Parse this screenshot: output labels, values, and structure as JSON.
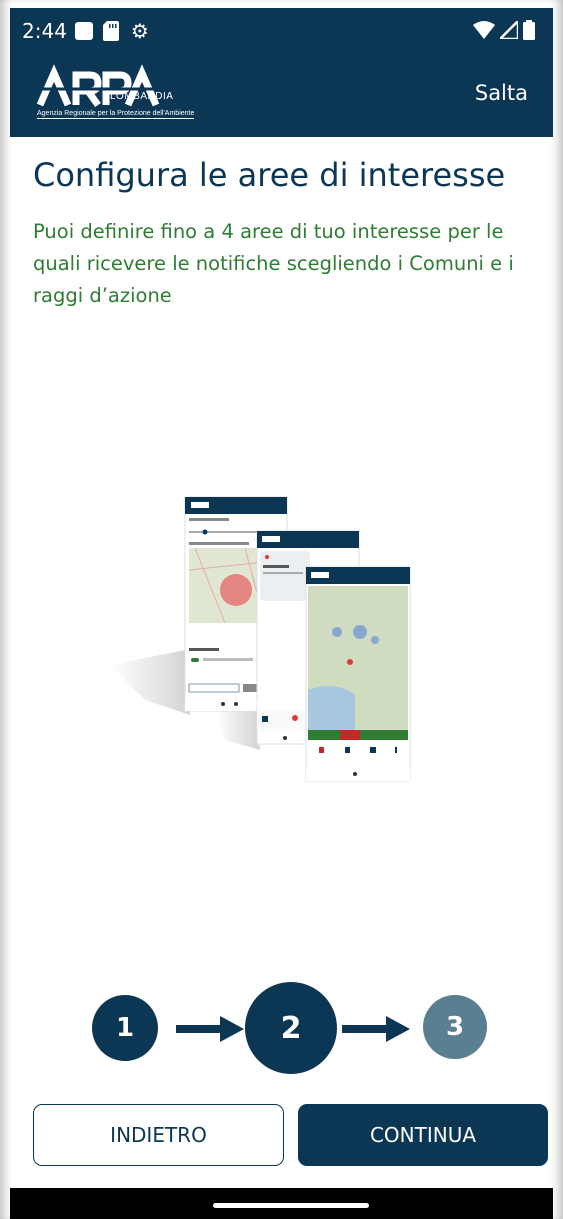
{
  "status_bar": {
    "time": "2:44",
    "icons": [
      "square-notification-icon",
      "sd-card-icon",
      "settings-icon",
      "wifi-icon",
      "signal-icon",
      "battery-icon"
    ]
  },
  "header": {
    "logo_text": "ARPA",
    "logo_region": "LOMBARDIA",
    "logo_subtitle": "Agenzia Regionale per la Protezione dell'Ambiente",
    "skip_label": "Salta"
  },
  "content": {
    "title": "Configura le aree di interesse",
    "description": "Puoi definire fino a 4 aree di tuo interesse per le quali ricevere le notifiche scegliendo i Comuni e i raggi d’azione"
  },
  "steps": {
    "items": [
      "1",
      "2",
      "3"
    ],
    "current": 2
  },
  "buttons": {
    "back_label": "INDIETRO",
    "continue_label": "CONTINUA"
  },
  "colors": {
    "primary": "#0b3654",
    "accent_text": "#2e7d32",
    "step_inactive": "#5a7f90",
    "background": "#ffffff"
  }
}
